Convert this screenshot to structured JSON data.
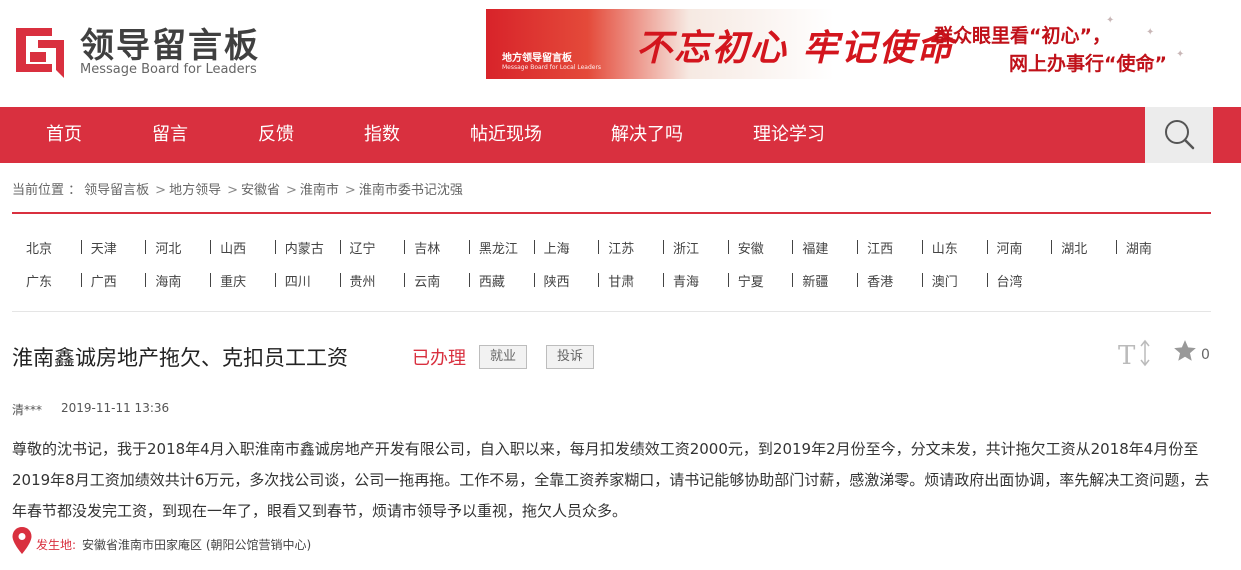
{
  "logo": {
    "title": "领导留言板",
    "subtitle": "Message Board for Leaders"
  },
  "banner": {
    "brand": "地方领导留言板",
    "brand_sub": "Message Board for Local Leaders",
    "calligraphy": "不忘初心 牢记使命",
    "line1": "群众眼里看“初心”，",
    "line2": "网上办事行“使命”"
  },
  "nav": {
    "items": [
      "首页",
      "留言",
      "反馈",
      "指数",
      "帖近现场",
      "解决了吗",
      "理论学习"
    ]
  },
  "breadcrumb": {
    "label": "当前位置 ：",
    "items": [
      "领导留言板",
      "地方领导",
      "安徽省",
      "淮南市",
      "淮南市委书记沈强"
    ],
    "separator": ">"
  },
  "regions": {
    "row1": [
      "北京",
      "天津",
      "河北",
      "山西",
      "内蒙古",
      "辽宁",
      "吉林",
      "黑龙江",
      "上海",
      "江苏",
      "浙江",
      "安徽",
      "福建",
      "江西",
      "山东",
      "河南",
      "湖北",
      "湖南"
    ],
    "row2": [
      "广东",
      "广西",
      "海南",
      "重庆",
      "四川",
      "贵州",
      "云南",
      "西藏",
      "陕西",
      "甘肃",
      "青海",
      "宁夏",
      "新疆",
      "香港",
      "澳门",
      "台湾"
    ]
  },
  "post": {
    "title": "淮南鑫诚房地产拖欠、克扣员工工资",
    "status": "已办理",
    "tags": [
      "就业",
      "投诉"
    ],
    "favorite_count": "0",
    "author": "清***",
    "time": "2019-11-11 13:36",
    "body": "尊敬的沈书记，我于2018年4月入职淮南市鑫诚房地产开发有限公司，自入职以来，每月扣发绩效工资2000元，到2019年2月份至今，分文未发，共计拖欠工资从2018年4月份至2019年8月工资加绩效共计6万元，多次找公司谈，公司一拖再拖。工作不易，全靠工资养家糊口，请书记能够协助部门讨薪，感激涕零。烦请政府出面协调，率先解决工资问题，去年春节都没发完工资，到现在一年了，眼看又到春节，烦请市领导予以重视，拖欠人员众多。",
    "location_label": "发生地:",
    "location": "安徽省淮南市田家庵区 (朝阳公馆营销中心)"
  },
  "colors": {
    "brand_red": "#d9303f",
    "status_red": "#d9303f"
  }
}
